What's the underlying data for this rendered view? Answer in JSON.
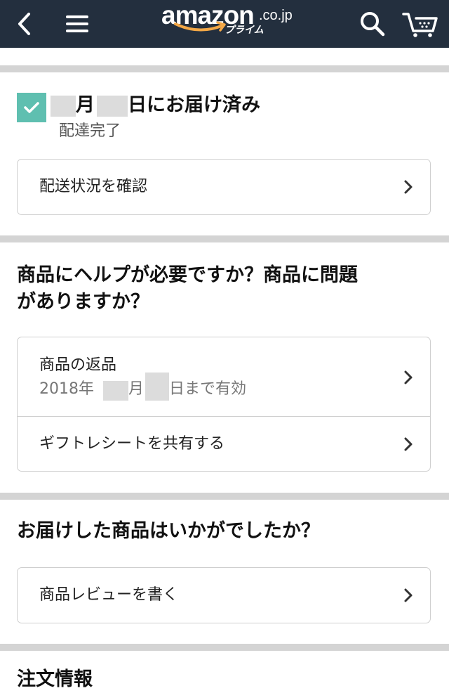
{
  "header": {
    "logo_word": "amazon",
    "logo_suffix": ".co.jp",
    "logo_prime": "プライム",
    "colors": {
      "background": "#232f3e",
      "smile": "#f3a847",
      "icon": "#ffffff"
    },
    "icons": [
      "back-icon",
      "menu-icon",
      "search-icon",
      "cart-icon"
    ]
  },
  "delivery": {
    "status_month_char": "月",
    "status_day_rest": "日にお届け済み",
    "sub": "配達完了",
    "check_color": "#5fbfb0",
    "track_button": "配送状況を確認"
  },
  "help": {
    "heading_line1": "商品にヘルプが必要ですか？商品に問題",
    "heading_line2": "がありますか？",
    "return_label": "商品の返品",
    "return_year": "2018年",
    "return_month_char": "月",
    "return_day_rest": "日まで有効",
    "gift_receipt_label": "ギフトレシートを共有する"
  },
  "feedback": {
    "heading": "お届けした商品はいかがでしたか？",
    "review_button": "商品レビューを書く"
  },
  "next_section": {
    "heading_partial": "注文情報"
  }
}
